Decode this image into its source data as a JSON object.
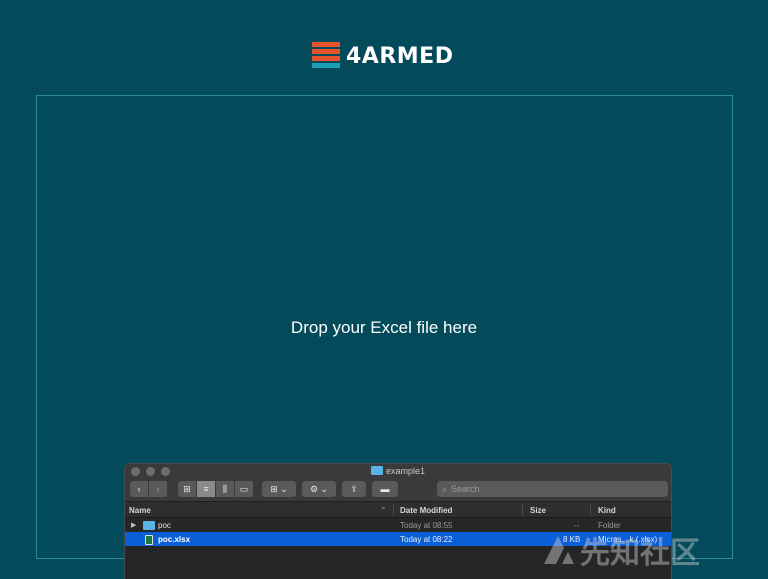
{
  "logo": {
    "text": "4ARMED",
    "colors": {
      "mark": "#e9532e",
      "mark_accent": "#1f9fb3"
    }
  },
  "dropzone": {
    "text": "Drop your Excel file here"
  },
  "finder": {
    "title": "example1",
    "search": {
      "placeholder": "Search"
    },
    "columns": {
      "name": "Name",
      "date_modified": "Date Modified",
      "size": "Size",
      "kind": "Kind"
    },
    "rows": [
      {
        "name": "poc",
        "date": "Today at 08:55",
        "size": "--",
        "kind": "Folder",
        "icon": "folder-icon",
        "selected": false
      },
      {
        "name": "poc.xlsx",
        "date": "Today at 08:22",
        "size": "8 KB",
        "kind": "Micros…k (.xlsx)",
        "icon": "excel-file-icon",
        "selected": true
      }
    ]
  },
  "watermark": {
    "text": "先知社区"
  },
  "colors": {
    "background": "#034a5a",
    "selection": "#0b5fd6"
  }
}
